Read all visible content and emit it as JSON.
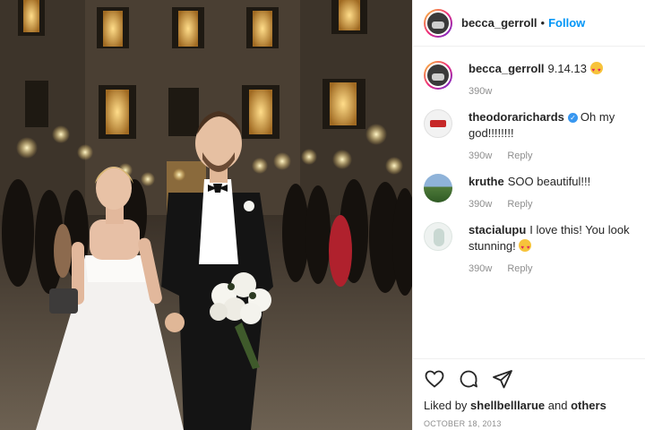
{
  "post": {
    "username": "becca_gerroll",
    "separator": "•",
    "follow_label": "Follow",
    "image_alt": "Bride and groom walking through sparklers at night",
    "caption": {
      "username": "becca_gerroll",
      "text": "9.14.13",
      "age": "390w"
    }
  },
  "comments": [
    {
      "username": "theodorarichards",
      "text": "Oh my god!!!!!!!!",
      "verified": true,
      "age": "390w",
      "reply_label": "Reply"
    },
    {
      "username": "kruthe",
      "text": "SOO beautiful!!!",
      "verified": false,
      "age": "390w",
      "reply_label": "Reply"
    },
    {
      "username": "stacialupu",
      "text": "I love this! You look stunning!",
      "verified": false,
      "age": "390w",
      "reply_label": "Reply"
    }
  ],
  "footer": {
    "likes_prefix": "Liked by",
    "likes_user": "shellbelllarue",
    "likes_and": "and",
    "likes_others": "others",
    "date": "OCTOBER 18, 2013"
  },
  "icons": {
    "like": "heart-icon",
    "comment": "comment-icon",
    "share": "share-icon",
    "emoji": "heart-eyes-emoji-icon",
    "verified": "verified-badge-icon"
  },
  "colors": {
    "follow": "#0095f6",
    "meta": "#8e8e8e",
    "text": "#262626",
    "verified": "#3897f0"
  }
}
